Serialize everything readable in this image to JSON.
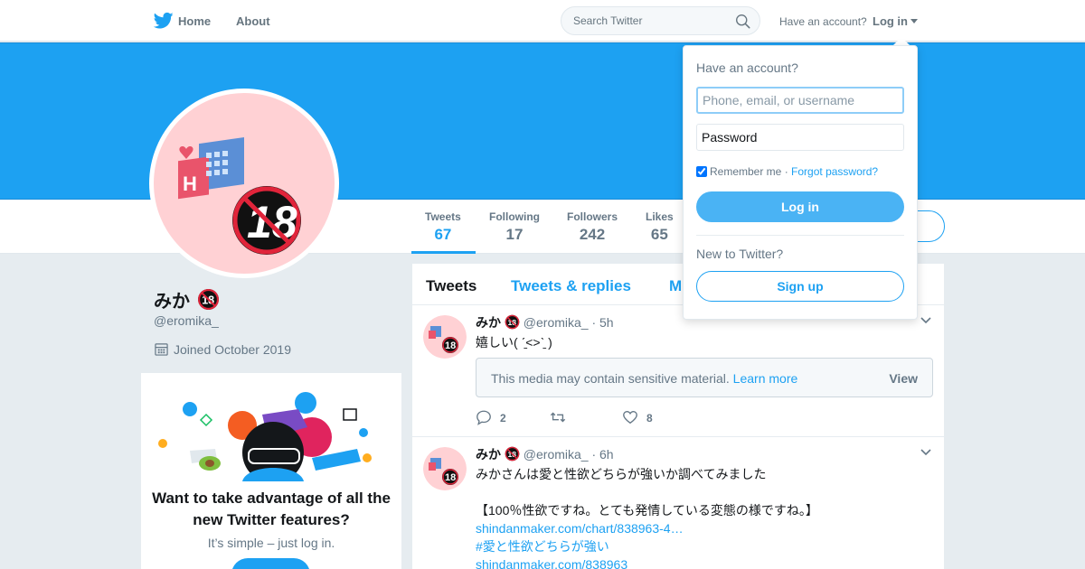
{
  "nav": {
    "home_label": "Home",
    "about_label": "About",
    "search_placeholder": "Search Twitter",
    "have_account_text": "Have an account?",
    "login_label": "Log in"
  },
  "profile": {
    "name": "みか",
    "handle": "@eromika_",
    "joined": "Joined October 2019",
    "stats": [
      {
        "label": "Tweets",
        "value": "67"
      },
      {
        "label": "Following",
        "value": "17"
      },
      {
        "label": "Followers",
        "value": "242"
      },
      {
        "label": "Likes",
        "value": "65"
      }
    ]
  },
  "signup_card": {
    "title": "Want to take advantage of all the new Twitter features?",
    "subtitle": "It’s simple – just log in."
  },
  "timeline": {
    "tabs": [
      "Tweets",
      "Tweets & replies",
      "M"
    ],
    "tweets": [
      {
        "name": "みか",
        "handle": "@eromika_",
        "time": "· 5h",
        "text": "嬉しい( ˊ̱˂˃ˋ̱ )",
        "media_warning": "This media may contain sensitive material.",
        "learn_more": "Learn more",
        "view_label": "View",
        "replies": "2",
        "retweets": "",
        "likes": "8"
      },
      {
        "name": "みか",
        "handle": "@eromika_",
        "time": "· 6h",
        "text_line1": "みかさんは愛と性欲どちらが強いか調べてみました",
        "text_line2": "【100％性欲ですね。とても発情している変態の様ですね。】",
        "link1": "shindanmaker.com/chart/838963-4…",
        "link2": "#愛と性欲どちらが強い",
        "link3": "shindanmaker.com/838963"
      }
    ]
  },
  "login_dropdown": {
    "title": "Have an account?",
    "username_placeholder": "Phone, email, or username",
    "password_placeholder": "Password",
    "remember_me": "Remember me",
    "separator": "·",
    "forgot_password": "Forgot password?",
    "login_button": "Log in",
    "new_to_twitter": "New to Twitter?",
    "signup_button": "Sign up"
  },
  "colors": {
    "accent": "#1da1f2",
    "banner": "#1da1f2",
    "background": "#e6ecf0",
    "avatar_bg": "#ffd1d4"
  }
}
